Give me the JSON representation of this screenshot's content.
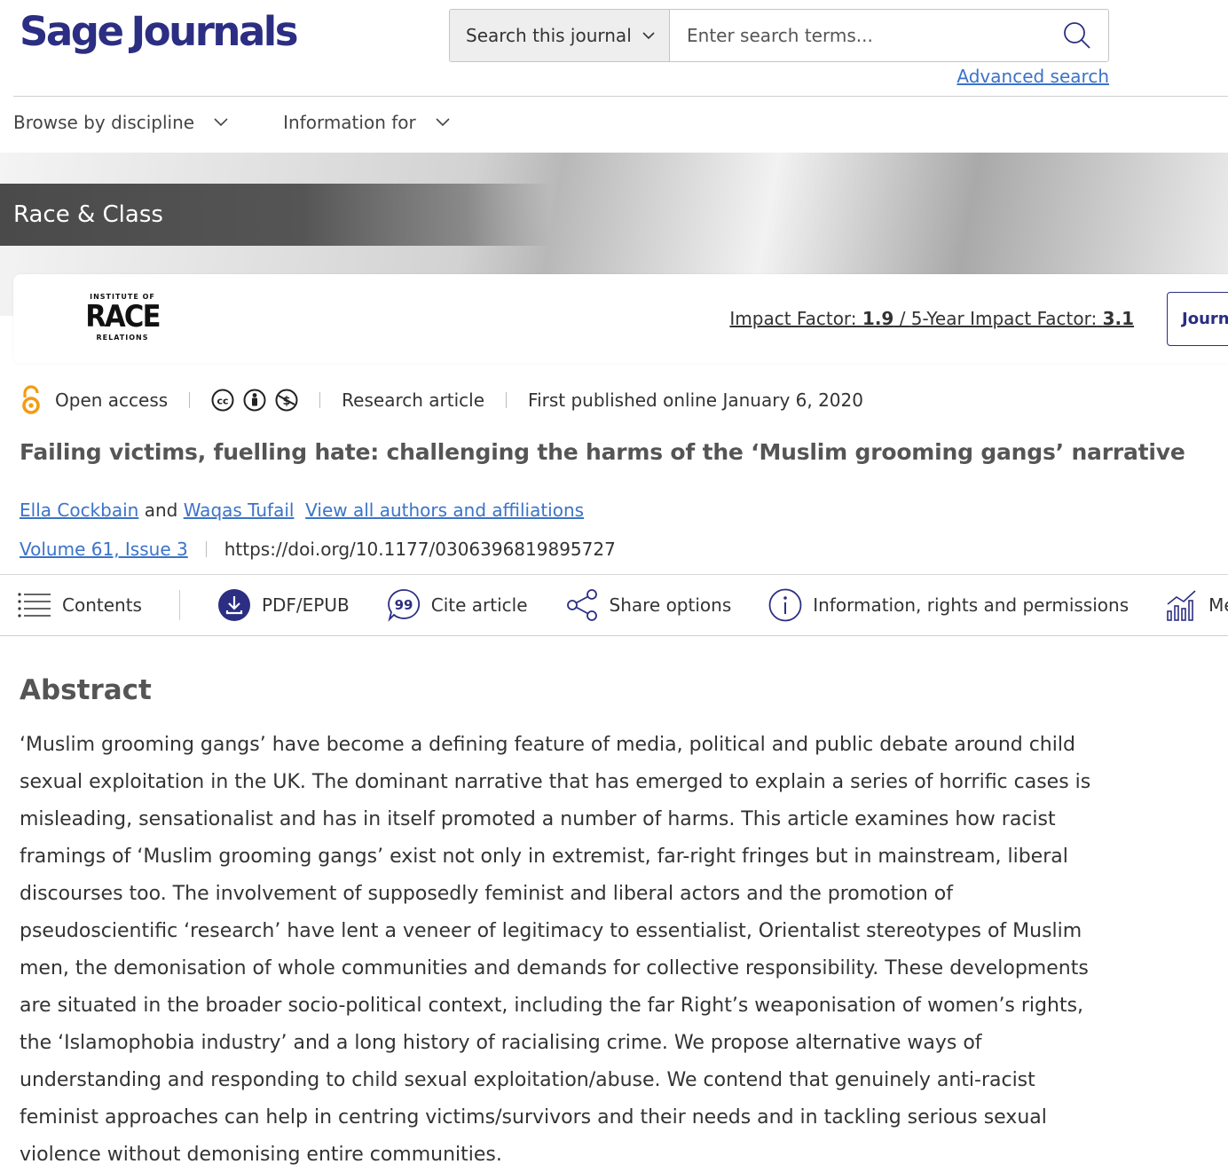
{
  "header": {
    "logo_part1": "Sage",
    "logo_part2": "Journals",
    "search": {
      "scope_label": "Search this journal",
      "placeholder": "Enter search terms..."
    },
    "advanced_search": "Advanced search",
    "nav": {
      "browse": "Browse by discipline",
      "info": "Information for"
    }
  },
  "journal": {
    "name": "Race & Class",
    "logo": {
      "line1": "INSTITUTE OF",
      "line2": "RACE",
      "line3": "RELATIONS"
    },
    "impact_factor_label": "Impact Factor:",
    "impact_factor_value": "1.9",
    "five_year_label": "5-Year Impact Factor:",
    "five_year_value": "3.1",
    "journal_button": "Journal"
  },
  "article": {
    "access": "Open access",
    "type": "Research article",
    "published": "First published online January 6, 2020",
    "title": "Failing victims, fuelling hate: challenging the harms of the ‘Muslim grooming gangs’ narrative",
    "author1": "Ella Cockbain",
    "and": "and",
    "author2": "Waqas Tufail",
    "view_all": "View all authors and affiliations",
    "volume": "Volume 61, Issue 3",
    "doi": "https://doi.org/10.1177/0306396819895727"
  },
  "toolbar": {
    "contents": "Contents",
    "pdf": "PDF/EPUB",
    "cite": "Cite article",
    "share": "Share options",
    "info": "Information, rights and permissions",
    "metrics": "Metrics"
  },
  "abstract": {
    "heading": "Abstract",
    "text": "‘Muslim grooming gangs’ have become a defining feature of media, political and public debate around child sexual exploitation in the UK. The dominant narrative that has emerged to explain a series of horrific cases is misleading, sensationalist and has in itself promoted a number of harms. This article examines how racist framings of ‘Muslim grooming gangs’ exist not only in extremist, far-right fringes but in mainstream, liberal discourses too. The involvement of supposedly feminist and liberal actors and the promotion of pseudoscientific ‘research’ have lent a veneer of legitimacy to essentialist, Orientalist stereotypes of Muslim men, the demonisation of whole communities and demands for collective responsibility. These developments are situated in the broader socio-political context, including the far Right’s weaponisation of women’s rights, the ‘Islamophobia industry’ and a long history of racialising crime. We propose alternative ways of understanding and responding to child sexual exploitation/abuse. We contend that genuinely anti-racist feminist approaches can help in centring victims/survivors and their needs and in tackling serious sexual violence without demonising entire communities."
  },
  "colors": {
    "brand": "#2b2e82",
    "link": "#3b73c8",
    "open_access": "#f39c12"
  }
}
